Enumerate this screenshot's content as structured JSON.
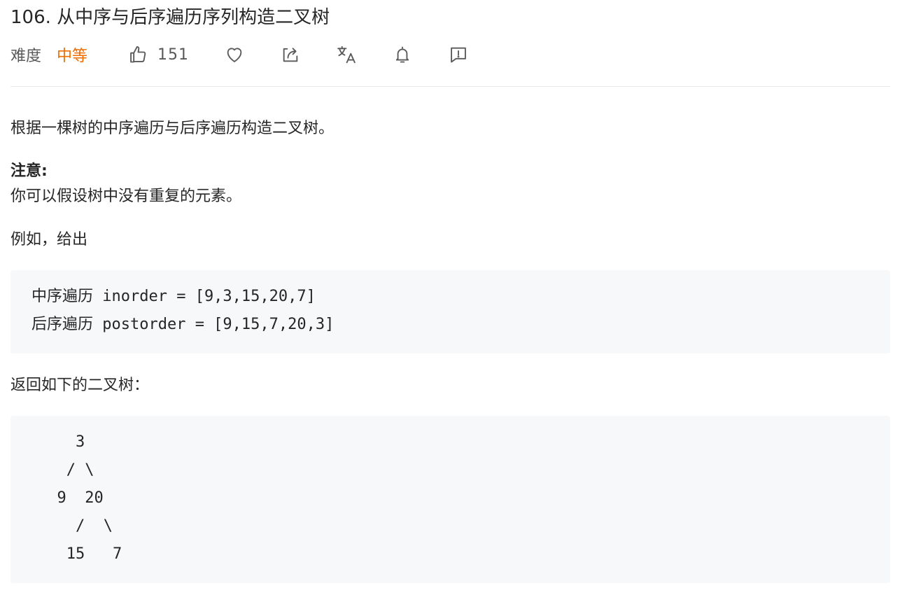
{
  "problem": {
    "title": "106. 从中序与后序遍历序列构造二叉树",
    "difficulty_label": "难度",
    "difficulty_value": "中等",
    "like_count": "151",
    "colors": {
      "difficulty_medium": "#ef6c00",
      "code_bg": "#f7f8fa",
      "divider": "#e8e8e8"
    },
    "actions": [
      {
        "icon": "thumbs-up-icon"
      },
      {
        "icon": "heart-icon"
      },
      {
        "icon": "share-icon"
      },
      {
        "icon": "translate-icon"
      },
      {
        "icon": "bell-icon"
      },
      {
        "icon": "feedback-icon"
      }
    ]
  },
  "content": {
    "intro": "根据一棵树的中序遍历与后序遍历构造二叉树。",
    "note_title": "注意:",
    "note_body": "你可以假设树中没有重复的元素。",
    "example_intro": "例如，给出",
    "example_code": "中序遍历 inorder = [9,3,15,20,7]\n后序遍历 postorder = [9,15,7,20,3]",
    "result_intro": "返回如下的二叉树：",
    "tree_code": "    3\n   / \\\n  9  20\n    /  \\\n   15   7"
  }
}
